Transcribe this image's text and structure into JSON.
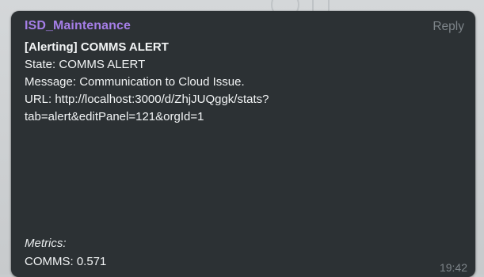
{
  "message": {
    "sender": "ISD_Maintenance",
    "reply_label": "Reply",
    "lines": {
      "title": "[Alerting] COMMS ALERT",
      "state": "State: COMMS ALERT",
      "message": "Message: Communication to Cloud Issue.",
      "url_line1": "URL: http://localhost:3000/d/ZhjJUQggk/stats?",
      "url_line2": "tab=alert&editPanel=121&orgId=1"
    },
    "metrics_label": "Metrics:",
    "metrics_value": "COMMS: 0.571",
    "timestamp": "19:42"
  },
  "colors": {
    "bubble_bg": "#2c3134",
    "sender": "#a57ee7",
    "muted": "#7d8489",
    "text": "#f2f4f5"
  }
}
